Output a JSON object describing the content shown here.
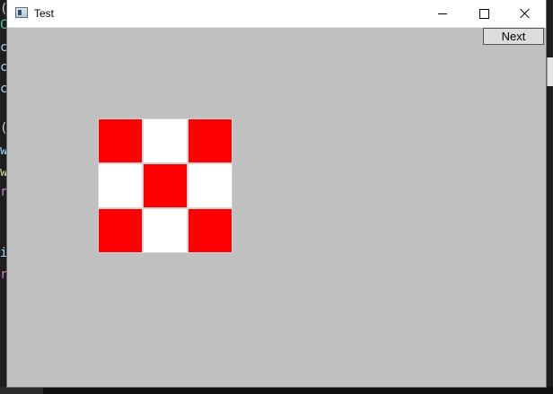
{
  "window": {
    "title": "Test",
    "icon": "app-window-icon",
    "controls": {
      "minimize": "minimize-icon",
      "maximize": "maximize-icon",
      "close": "close-icon"
    }
  },
  "toolbar": {
    "next_label": "Next"
  },
  "board": {
    "rows": [
      [
        "red",
        "white",
        "red"
      ],
      [
        "white",
        "red",
        "white"
      ],
      [
        "red",
        "white",
        "red"
      ]
    ],
    "colors": {
      "red": "#ff0000",
      "white": "#ffffff"
    }
  },
  "colors": {
    "client_background": "#c0c0c0",
    "titlebar_background": "#ffffff"
  },
  "background_editor": {
    "visible_chars": [
      "(",
      "C",
      "c",
      "c",
      "c",
      "(",
      "w",
      "w",
      "r",
      "i",
      "r"
    ]
  }
}
